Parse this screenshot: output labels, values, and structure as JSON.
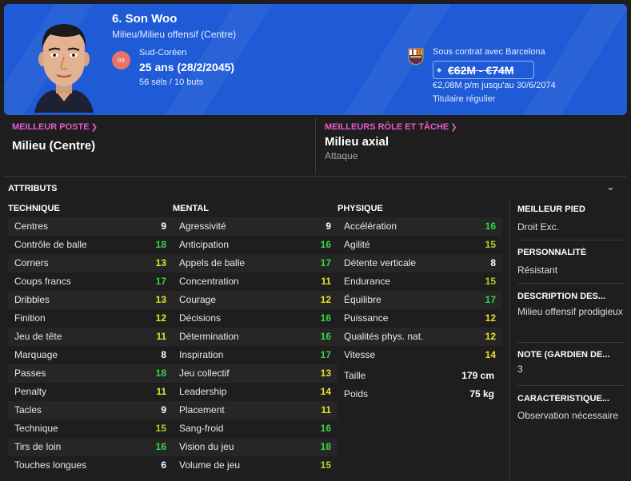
{
  "player": {
    "name": "6. Son Woo",
    "position": "Milieu/Milieu offensif (Centre)",
    "nation_badge": "Int",
    "nationality": "Sud-Coréen",
    "age": "25 ans (28/2/2045)",
    "caps": "56 séls / 10 buts"
  },
  "contract": {
    "label": "Sous contrat avec Barcelona",
    "value": "€62M - €74M",
    "wage": "€2,08M p/m jusqu'au 30/6/2074",
    "status": "Titulaire régulier"
  },
  "best_position": {
    "label": "MEILLEUR POSTE",
    "value": "Milieu (Centre)"
  },
  "best_role": {
    "label": "MEILLEURS RÔLE ET TÂCHE",
    "value": "Milieu axial",
    "duty": "Attaque"
  },
  "attributes": {
    "title": "ATTRIBUTS",
    "technical": {
      "header": "TECHNIQUE",
      "items": [
        {
          "name": "Centres",
          "value": "9"
        },
        {
          "name": "Contrôle de balle",
          "value": "18"
        },
        {
          "name": "Corners",
          "value": "13"
        },
        {
          "name": "Coups francs",
          "value": "17"
        },
        {
          "name": "Dribbles",
          "value": "13"
        },
        {
          "name": "Finition",
          "value": "12"
        },
        {
          "name": "Jeu de tête",
          "value": "11"
        },
        {
          "name": "Marquage",
          "value": "8"
        },
        {
          "name": "Passes",
          "value": "18"
        },
        {
          "name": "Penalty",
          "value": "11"
        },
        {
          "name": "Tacles",
          "value": "9"
        },
        {
          "name": "Technique",
          "value": "15"
        },
        {
          "name": "Tirs de loin",
          "value": "16"
        },
        {
          "name": "Touches longues",
          "value": "6"
        }
      ]
    },
    "mental": {
      "header": "MENTAL",
      "items": [
        {
          "name": "Agressivité",
          "value": "9"
        },
        {
          "name": "Anticipation",
          "value": "16"
        },
        {
          "name": "Appels de balle",
          "value": "17"
        },
        {
          "name": "Concentration",
          "value": "11"
        },
        {
          "name": "Courage",
          "value": "12"
        },
        {
          "name": "Décisions",
          "value": "16"
        },
        {
          "name": "Détermination",
          "value": "16"
        },
        {
          "name": "Inspiration",
          "value": "17"
        },
        {
          "name": "Jeu collectif",
          "value": "13"
        },
        {
          "name": "Leadership",
          "value": "14"
        },
        {
          "name": "Placement",
          "value": "11"
        },
        {
          "name": "Sang-froid",
          "value": "16"
        },
        {
          "name": "Vision du jeu",
          "value": "18"
        },
        {
          "name": "Volume de jeu",
          "value": "15"
        }
      ]
    },
    "physical": {
      "header": "PHYSIQUE",
      "items": [
        {
          "name": "Accélération",
          "value": "16"
        },
        {
          "name": "Agilité",
          "value": "15"
        },
        {
          "name": "Détente verticale",
          "value": "8"
        },
        {
          "name": "Endurance",
          "value": "15"
        },
        {
          "name": "Équilibre",
          "value": "17"
        },
        {
          "name": "Puissance",
          "value": "12"
        },
        {
          "name": "Qualités phys. nat.",
          "value": "12"
        },
        {
          "name": "Vitesse",
          "value": "14"
        }
      ],
      "height_label": "Taille",
      "height": "179 cm",
      "weight_label": "Poids",
      "weight": "75 kg"
    }
  },
  "info": {
    "foot_label": "MEILLEUR PIED",
    "foot": "Droit Exc.",
    "personality_label": "PERSONNALITÉ",
    "personality": "Résistant",
    "description_label": "DESCRIPTION DES...",
    "description": "Milieu offensif prodigieux",
    "gk_rating_label": "NOTE (GARDIEN DE...",
    "gk_rating": "3",
    "traits_label": "CARACTÉRISTIQUE...",
    "traits": "Observation nécessaire"
  },
  "colors": {
    "header_blue": "#1f5bd6",
    "link_pink": "#e85ac9",
    "attr_green": "#39d44a",
    "attr_yellow": "#e8e028"
  },
  "icons": {
    "face": "player-face-icon",
    "crest": "club-crest-icon",
    "toggle": "chevron-down-icon"
  }
}
